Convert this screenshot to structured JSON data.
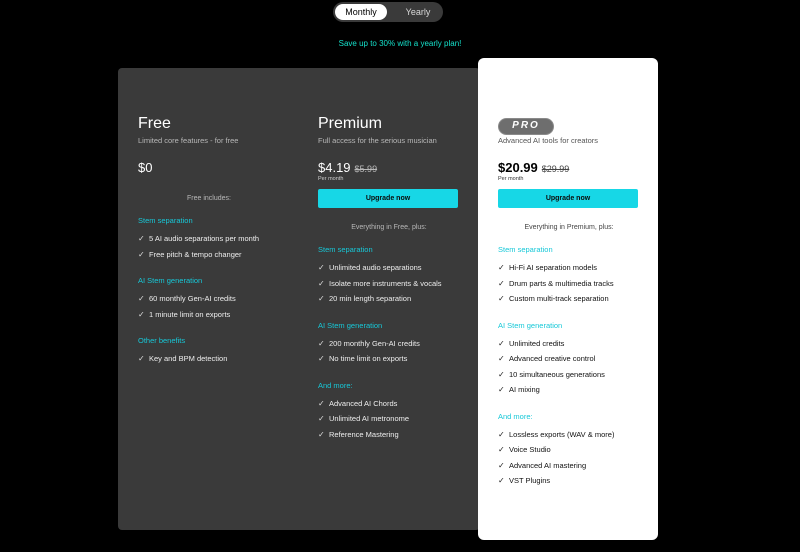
{
  "billing_toggle": {
    "monthly_label": "Monthly",
    "yearly_label": "Yearly",
    "selected": "Monthly"
  },
  "promo": "Save up to 30% with a yearly plan!",
  "colors": {
    "accent": "#17d7e6",
    "promo": "#15e0ca",
    "dark_panel": "#3a3a3a",
    "pro_panel": "#ffffff"
  },
  "plans": {
    "free": {
      "title": "Free",
      "subtitle": "Limited core features - for free",
      "price": "$0",
      "includes": "Free includes:",
      "sections": [
        {
          "heading": "Stem separation",
          "items": [
            "5 AI audio separations per month",
            "Free pitch & tempo changer"
          ]
        },
        {
          "heading": "AI Stem generation",
          "items": [
            "60 monthly Gen-AI credits",
            "1 minute limit on exports"
          ]
        },
        {
          "heading": "Other benefits",
          "items": [
            "Key and BPM detection"
          ]
        }
      ]
    },
    "premium": {
      "title": "Premium",
      "subtitle": "Full access for the serious musician",
      "price": "$4.19",
      "old_price": "$5.99",
      "per": "Per month",
      "button": "Upgrade now",
      "includes": "Everything in Free, plus:",
      "sections": [
        {
          "heading": "Stem separation",
          "items": [
            "Unlimited audio separations",
            "Isolate more instruments & vocals",
            "20 min length separation"
          ]
        },
        {
          "heading": "AI Stem generation",
          "items": [
            "200 monthly Gen-AI credits",
            "No time limit on exports"
          ]
        },
        {
          "heading": "And more:",
          "items": [
            "Advanced AI Chords",
            "Unlimited AI metronome",
            "Reference Mastering"
          ]
        }
      ]
    },
    "pro": {
      "badge": "PRO",
      "subtitle": "Advanced AI tools for creators",
      "price": "$20.99",
      "old_price": "$29.99",
      "per": "Per month",
      "button": "Upgrade now",
      "includes": "Everything in Premium, plus:",
      "sections": [
        {
          "heading": "Stem separation",
          "items": [
            "Hi-Fi AI separation models",
            "Drum parts & multimedia tracks",
            "Custom multi-track separation"
          ]
        },
        {
          "heading": "AI Stem generation",
          "items": [
            "Unlimited credits",
            "Advanced creative control",
            "10 simultaneous generations",
            "AI mixing"
          ]
        },
        {
          "heading": "And more:",
          "items": [
            "Lossless exports (WAV & more)",
            "Voice Studio",
            "Advanced AI mastering",
            "VST Plugins"
          ]
        }
      ]
    }
  }
}
